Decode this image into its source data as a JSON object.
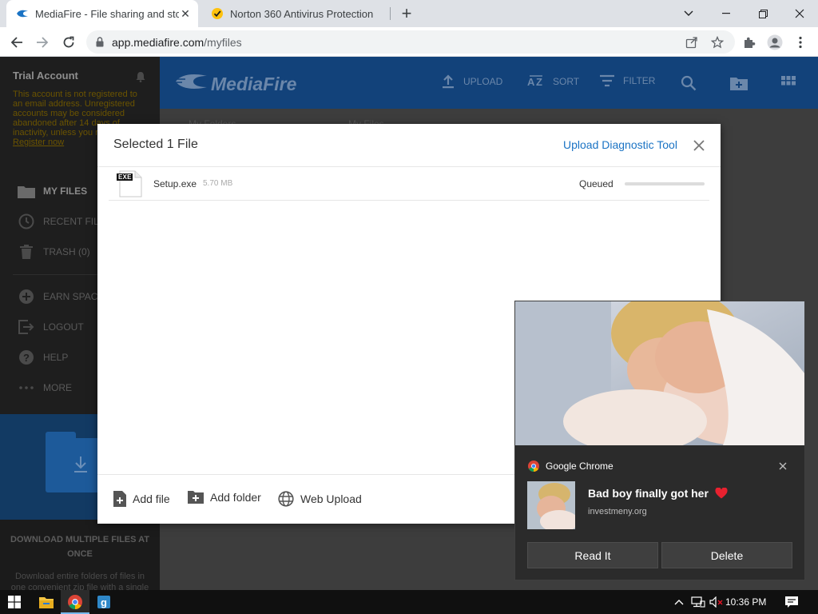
{
  "browser": {
    "tabs": [
      {
        "title": "MediaFire - File sharing and storage",
        "active": true
      },
      {
        "title": "Norton 360 Antivirus Protection",
        "active": false
      }
    ],
    "url_host": "app.mediafire.com",
    "url_path": "/myfiles"
  },
  "sidebar": {
    "account_title": "Trial Account",
    "trial_notice": "This account is not registered to an email address. Unregistered accounts may be considered abandoned after 14 days of inactivity, unless you register.",
    "register_link": "Register now",
    "nav": {
      "my_files": "MY FILES",
      "recent_files": "RECENT FILES",
      "trash": "TRASH (0)",
      "earn_space": "EARN SPACE",
      "logout": "LOGOUT",
      "help": "HELP",
      "more": "MORE"
    },
    "promo_title": "DOWNLOAD MULTIPLE FILES AT ONCE",
    "promo_text": "Download entire folders of files in one convenient zip file with a single"
  },
  "mediafire": {
    "logo": "MediaFire",
    "actions": {
      "upload": "UPLOAD",
      "sort": "SORT",
      "filter": "FILTER"
    },
    "breadcrumb_1": "My Folders",
    "breadcrumb_2": "My Files"
  },
  "upload_dialog": {
    "title": "Selected 1 File",
    "diagnostic_link": "Upload Diagnostic Tool",
    "file": {
      "name": "Setup.exe",
      "size": "5.70 MB",
      "status": "Queued",
      "icon_label": "EXE",
      "progress": 0
    },
    "footer": {
      "add_file": "Add file",
      "add_folder": "Add folder",
      "web_upload": "Web Upload"
    }
  },
  "notification": {
    "source": "Google Chrome",
    "title": "Bad boy finally got her",
    "site": "investmeny.org",
    "buttons": {
      "read": "Read It",
      "delete": "Delete"
    }
  },
  "taskbar": {
    "time": "10:36 PM"
  }
}
